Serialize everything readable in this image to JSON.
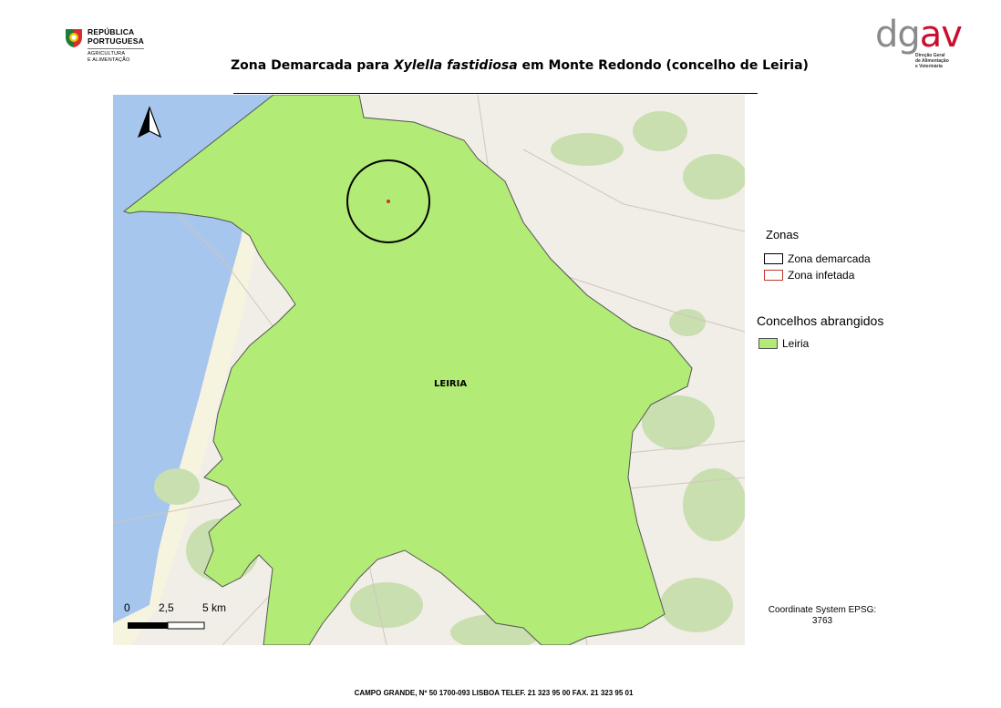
{
  "header": {
    "left_logo": {
      "line1": "REPÚBLICA",
      "line2": "PORTUGUESA",
      "ministry1": "AGRICULTURA",
      "ministry2": "E ALIMENTAÇÃO"
    },
    "right_logo": {
      "mark_dg": "dg",
      "mark_av": "av",
      "sub1": "Direção Geral",
      "sub2": "de Alimentação",
      "sub3": "e Veterinária"
    }
  },
  "title": {
    "prefix": "Zona Demarcada para ",
    "species": "Xylella fastidiosa",
    "suffix": " em Monte Redondo (concelho de Leiria)"
  },
  "map": {
    "region_label": "LEIRIA",
    "north_arrow_icon": "north-arrow-icon",
    "scale": {
      "t0": "0",
      "t1": "2,5",
      "t2": "5 km"
    },
    "colors": {
      "municipality": "#b2eb76",
      "sea": "#a6c6ee",
      "zone_demarcated": "#000000",
      "zone_infected": "#c0392b"
    }
  },
  "legend": {
    "zones_heading": "Zonas",
    "zone_demarcated": "Zona demarcada",
    "zone_infected": "Zona infetada",
    "municipalities_heading": "Concelhos abrangidos",
    "municipality": "Leiria"
  },
  "coordinate_system": {
    "line1": "Coordinate System EPSG:",
    "line2": "3763"
  },
  "footer": "CAMPO GRANDE, Nº 50 1700-093 LISBOA TELEF. 21 323 95 00 FAX. 21 323 95 01"
}
